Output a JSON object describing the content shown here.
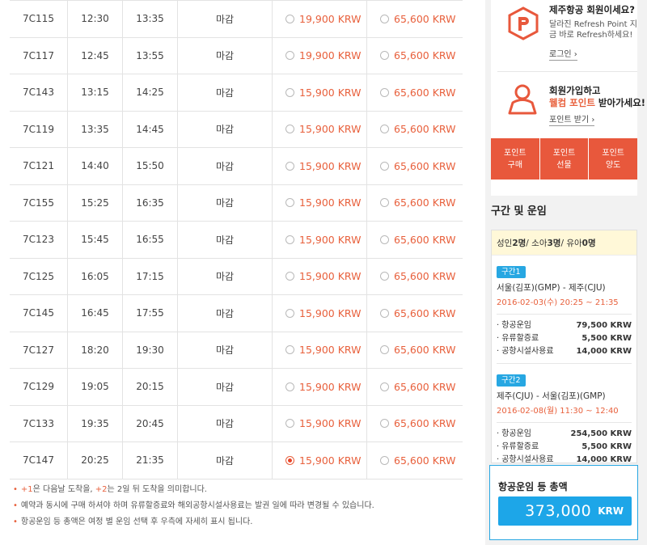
{
  "flights": [
    {
      "no": "7C115",
      "dep": "12:30",
      "arr": "13:35",
      "status": "마감",
      "fare1": "19,900 KRW",
      "fare2": "65,600 KRW",
      "fare1_selected": false
    },
    {
      "no": "7C117",
      "dep": "12:45",
      "arr": "13:55",
      "status": "마감",
      "fare1": "19,900 KRW",
      "fare2": "65,600 KRW",
      "fare1_selected": false
    },
    {
      "no": "7C143",
      "dep": "13:15",
      "arr": "14:25",
      "status": "마감",
      "fare1": "15,900 KRW",
      "fare2": "65,600 KRW",
      "fare1_selected": false
    },
    {
      "no": "7C119",
      "dep": "13:35",
      "arr": "14:45",
      "status": "마감",
      "fare1": "15,900 KRW",
      "fare2": "65,600 KRW",
      "fare1_selected": false
    },
    {
      "no": "7C121",
      "dep": "14:40",
      "arr": "15:50",
      "status": "마감",
      "fare1": "15,900 KRW",
      "fare2": "65,600 KRW",
      "fare1_selected": false
    },
    {
      "no": "7C155",
      "dep": "15:25",
      "arr": "16:35",
      "status": "마감",
      "fare1": "15,900 KRW",
      "fare2": "65,600 KRW",
      "fare1_selected": false
    },
    {
      "no": "7C123",
      "dep": "15:45",
      "arr": "16:55",
      "status": "마감",
      "fare1": "15,900 KRW",
      "fare2": "65,600 KRW",
      "fare1_selected": false
    },
    {
      "no": "7C125",
      "dep": "16:05",
      "arr": "17:15",
      "status": "마감",
      "fare1": "15,900 KRW",
      "fare2": "65,600 KRW",
      "fare1_selected": false
    },
    {
      "no": "7C145",
      "dep": "16:45",
      "arr": "17:55",
      "status": "마감",
      "fare1": "15,900 KRW",
      "fare2": "65,600 KRW",
      "fare1_selected": false
    },
    {
      "no": "7C127",
      "dep": "18:20",
      "arr": "19:30",
      "status": "마감",
      "fare1": "15,900 KRW",
      "fare2": "65,600 KRW",
      "fare1_selected": false
    },
    {
      "no": "7C129",
      "dep": "19:05",
      "arr": "20:15",
      "status": "마감",
      "fare1": "15,900 KRW",
      "fare2": "65,600 KRW",
      "fare1_selected": false
    },
    {
      "no": "7C133",
      "dep": "19:35",
      "arr": "20:45",
      "status": "마감",
      "fare1": "15,900 KRW",
      "fare2": "65,600 KRW",
      "fare1_selected": false
    },
    {
      "no": "7C147",
      "dep": "20:25",
      "arr": "21:35",
      "status": "마감",
      "fare1": "15,900 KRW",
      "fare2": "65,600 KRW",
      "fare1_selected": true
    }
  ],
  "notes": {
    "n1_plus1": "+1",
    "n1_mid": "은 다음날 도착을, ",
    "n1_plus2": "+2",
    "n1_end": "는 2일 뒤 도착을 의미합니다.",
    "n2": "예약과 동시에 구매 하셔야 하며 유류할증료와 해외공항시설사용료는 발권 일에 따라 변경될 수 있습니다.",
    "n3": "항공운임 등 총액은 여정 별 운임 선택 후 우측에 자세히 표시 됩니다."
  },
  "sidebar": {
    "member_title": "제주항공 회원이세요?",
    "member_desc": "달라진 Refresh Point 지금 바로 Refresh하세요!",
    "login_link": "로그인 ›",
    "join_title": "회원가입하고",
    "join_title2_hl": "웰컴 포인트",
    "join_title2_rest": " 받아가세요!",
    "point_link": "포인트 받기 ›",
    "point_buttons": [
      {
        "line1": "포인트",
        "line2": "구매"
      },
      {
        "line1": "포인트",
        "line2": "선물"
      },
      {
        "line1": "포인트",
        "line2": "양도"
      }
    ],
    "fare_heading": "구간 및 운임",
    "pax": {
      "adult_lbl": "성인",
      "adult": "2명",
      "child_lbl": " / 소아",
      "child": "3명",
      "infant_lbl": " / 유아",
      "infant": "0명"
    },
    "segments": [
      {
        "badge": "구간1",
        "route": "서울(김포)(GMP) - 제주(CJU)",
        "date": "2016-02-03(수) 20:25 ~ 21:35",
        "lines": [
          {
            "label": "항공운임",
            "value": "79,500 KRW"
          },
          {
            "label": "유류할증료",
            "value": "5,500 KRW"
          },
          {
            "label": "공항시설사용료",
            "value": "14,000 KRW"
          }
        ]
      },
      {
        "badge": "구간2",
        "route": "제주(CJU) - 서울(김포)(GMP)",
        "date": "2016-02-08(월) 11:30 ~ 12:40",
        "lines": [
          {
            "label": "항공운임",
            "value": "254,500 KRW"
          },
          {
            "label": "유류할증료",
            "value": "5,500 KRW"
          },
          {
            "label": "공항시설사용료",
            "value": "14,000 KRW"
          }
        ]
      }
    ],
    "total_label": "항공운임 등 총액",
    "total_value": "373,000",
    "total_unit": "KRW"
  },
  "colors": {
    "accent": "#e8603c",
    "button_orange": "#e8583c",
    "blue": "#1da6e8",
    "badge_blue": "#27a7e2"
  }
}
